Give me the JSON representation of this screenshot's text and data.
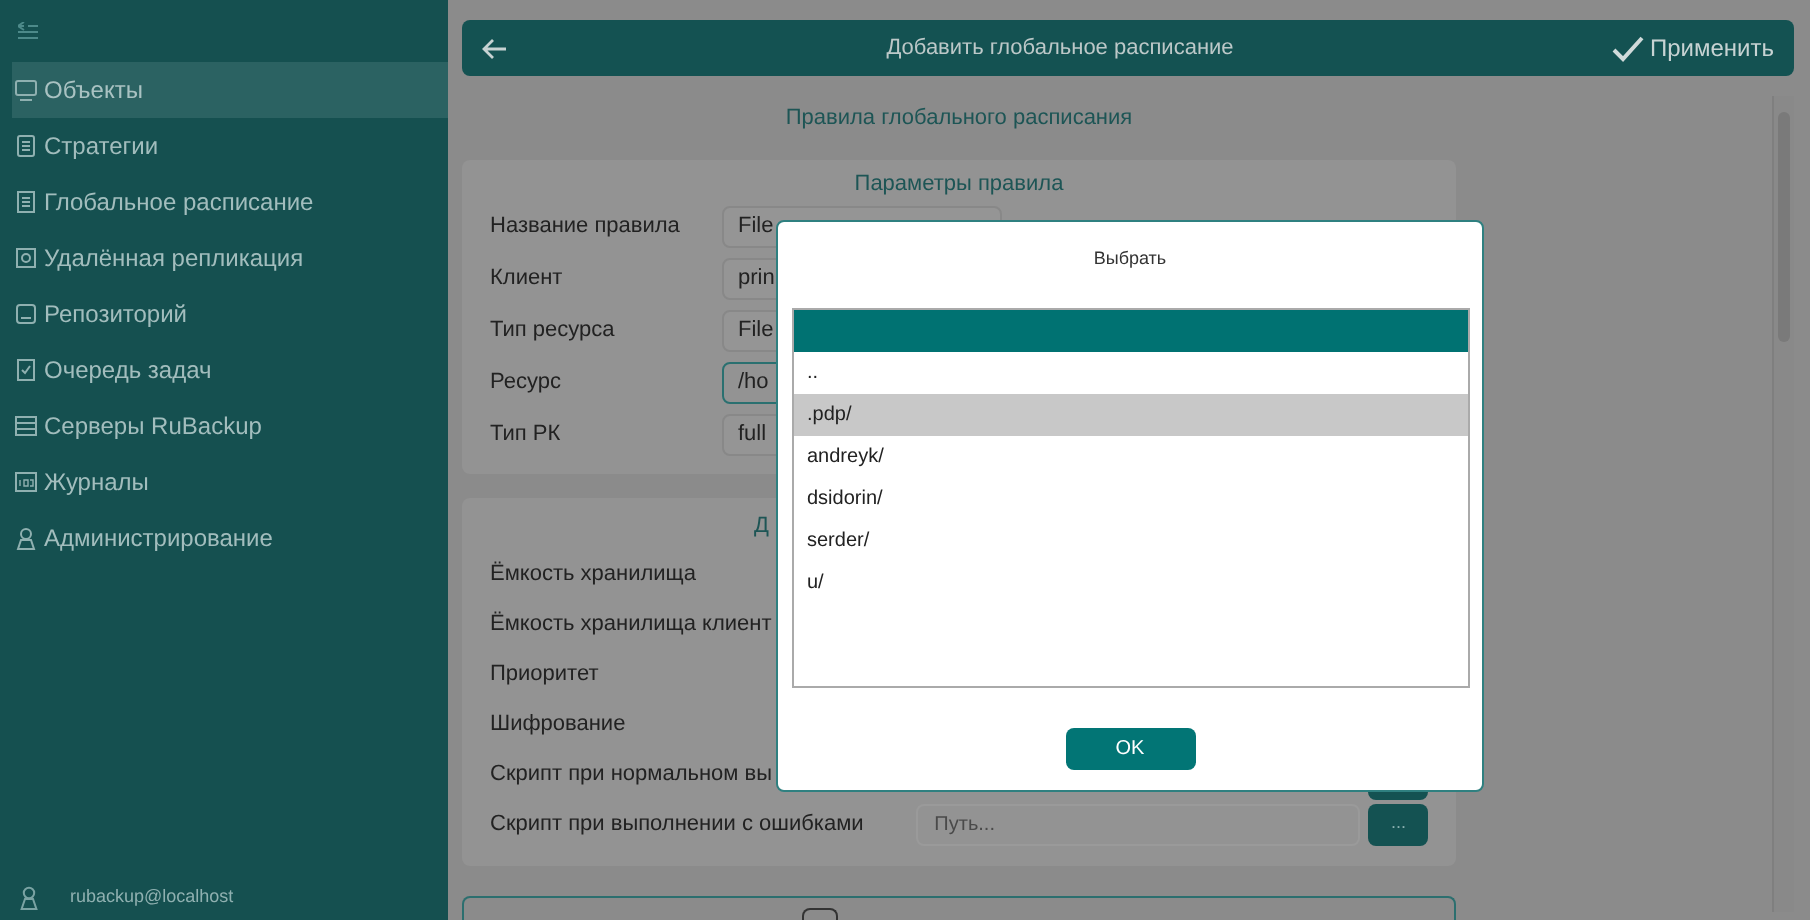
{
  "sidebar": {
    "items": [
      {
        "label": "Объекты",
        "selected": true
      },
      {
        "label": "Стратегии",
        "selected": false
      },
      {
        "label": "Глобальное расписание",
        "selected": false
      },
      {
        "label": "Удалённая репликация",
        "selected": false
      },
      {
        "label": "Репозиторий",
        "selected": false
      },
      {
        "label": "Очередь задач",
        "selected": false
      },
      {
        "label": "Серверы RuBackup",
        "selected": false
      },
      {
        "label": "Журналы",
        "selected": false
      },
      {
        "label": "Администрирование",
        "selected": false
      }
    ],
    "user": "rubackup@localhost"
  },
  "header": {
    "title": "Добавить глобальное расписание",
    "apply": "Применить"
  },
  "section_title": "Правила глобального расписания",
  "rule_card": {
    "title": "Параметры правила",
    "rows": [
      {
        "label": "Название правила",
        "value": "File",
        "focused": false
      },
      {
        "label": "Клиент",
        "value": "prin",
        "focused": false
      },
      {
        "label": "Тип ресурса",
        "value": "File",
        "focused": false
      },
      {
        "label": "Ресурс",
        "value": "/ho",
        "focused": true
      },
      {
        "label": "Тип РК",
        "value": "full",
        "focused": false
      }
    ]
  },
  "extra_card": {
    "title": "Д",
    "rows": [
      {
        "label": "Ёмкость хранилища",
        "kind": "text"
      },
      {
        "label": "Ёмкость хранилища клиент",
        "kind": "text"
      },
      {
        "label": "Приоритет",
        "kind": "text"
      },
      {
        "label": "Шифрование",
        "kind": "text"
      },
      {
        "label": "Скрипт при нормальном вы",
        "kind": "path-hidden"
      },
      {
        "label": "Скрипт при выполнении с ошибками",
        "kind": "path",
        "placeholder": "Путь...",
        "button": "..."
      }
    ]
  },
  "dialog": {
    "title": "Выбрать",
    "entries": [
      {
        "name": "..",
        "selected": false
      },
      {
        "name": ".pdp/",
        "selected": true
      },
      {
        "name": "andreyk/",
        "selected": false
      },
      {
        "name": "dsidorin/",
        "selected": false
      },
      {
        "name": "serder/",
        "selected": false
      },
      {
        "name": "u/",
        "selected": false
      }
    ],
    "ok": "OK"
  }
}
